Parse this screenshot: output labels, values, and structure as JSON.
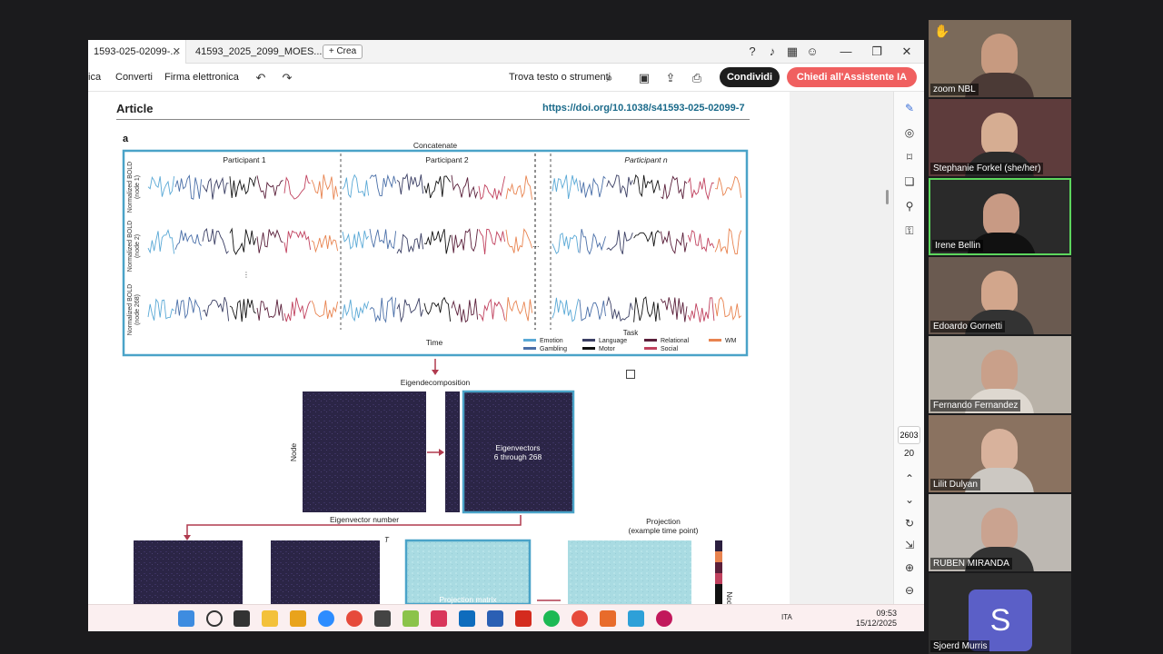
{
  "tabs": {
    "tab1": "1593-025-02099-...",
    "tab2": "41593_2025_2099_MOES...",
    "new_tab": "+ Crea"
  },
  "toolbar": {
    "item1": "ica",
    "item2": "Converti",
    "item3": "Firma elettronica",
    "find": "Trova testo o strumenti",
    "share": "Condividi",
    "ai": "Chiedi all'Assistente IA"
  },
  "article": {
    "title": "Article",
    "doi": "https://doi.org/10.1038/s41593-025-02099-7",
    "panel": "a"
  },
  "figure": {
    "concatenate": "Concatenate",
    "p1": "Participant 1",
    "p2": "Participant 2",
    "pn": "Participant n",
    "ylab1": "Normalized BOLD",
    "ylab1b": "(node 1)",
    "ylab2": "Normalized BOLD",
    "ylab2b": "(node 2)",
    "ylab3": "Normalized BOLD",
    "ylab3b": "(node 268)",
    "vdots": "⋮",
    "hdots": "...",
    "time": "Time",
    "task": "Task",
    "legend": [
      {
        "label": "Emotion",
        "color": "#5aa9d6"
      },
      {
        "label": "Gambling",
        "color": "#4a6fa8"
      },
      {
        "label": "Language",
        "color": "#3b3f64"
      },
      {
        "label": "Motor",
        "color": "#111111"
      },
      {
        "label": "Relational",
        "color": "#5a1f3a"
      },
      {
        "label": "Social",
        "color": "#c0415e"
      },
      {
        "label": "WM",
        "color": "#e8834f"
      }
    ],
    "eigendecomp": "Eigendecomposition",
    "node": "Node",
    "eigvec_title": "Eigenvectors",
    "eigvec_sub": "6 through 268",
    "eig_number": "Eigenvector number",
    "projection": "Projection",
    "projection_sub": "(example time point)",
    "superscript_t": "T",
    "proj_matrix": "Projection matrix",
    "node2": "Node"
  },
  "rail": {
    "page": "2603",
    "count": "20"
  },
  "clock": {
    "time": "09:53",
    "date": "15/12/2025",
    "lang": "ITA"
  },
  "participants": [
    {
      "name": "zoom NBL"
    },
    {
      "name": "Stephanie Forkel (she/her)"
    },
    {
      "name": "Irene Bellin"
    },
    {
      "name": "Edoardo Gornetti"
    },
    {
      "name": "Fernando Fernandez"
    },
    {
      "name": "Lilit Dulyan"
    },
    {
      "name": "RUBEN MIRANDA"
    },
    {
      "name": "Sjoerd Murris",
      "initial": "S"
    }
  ]
}
